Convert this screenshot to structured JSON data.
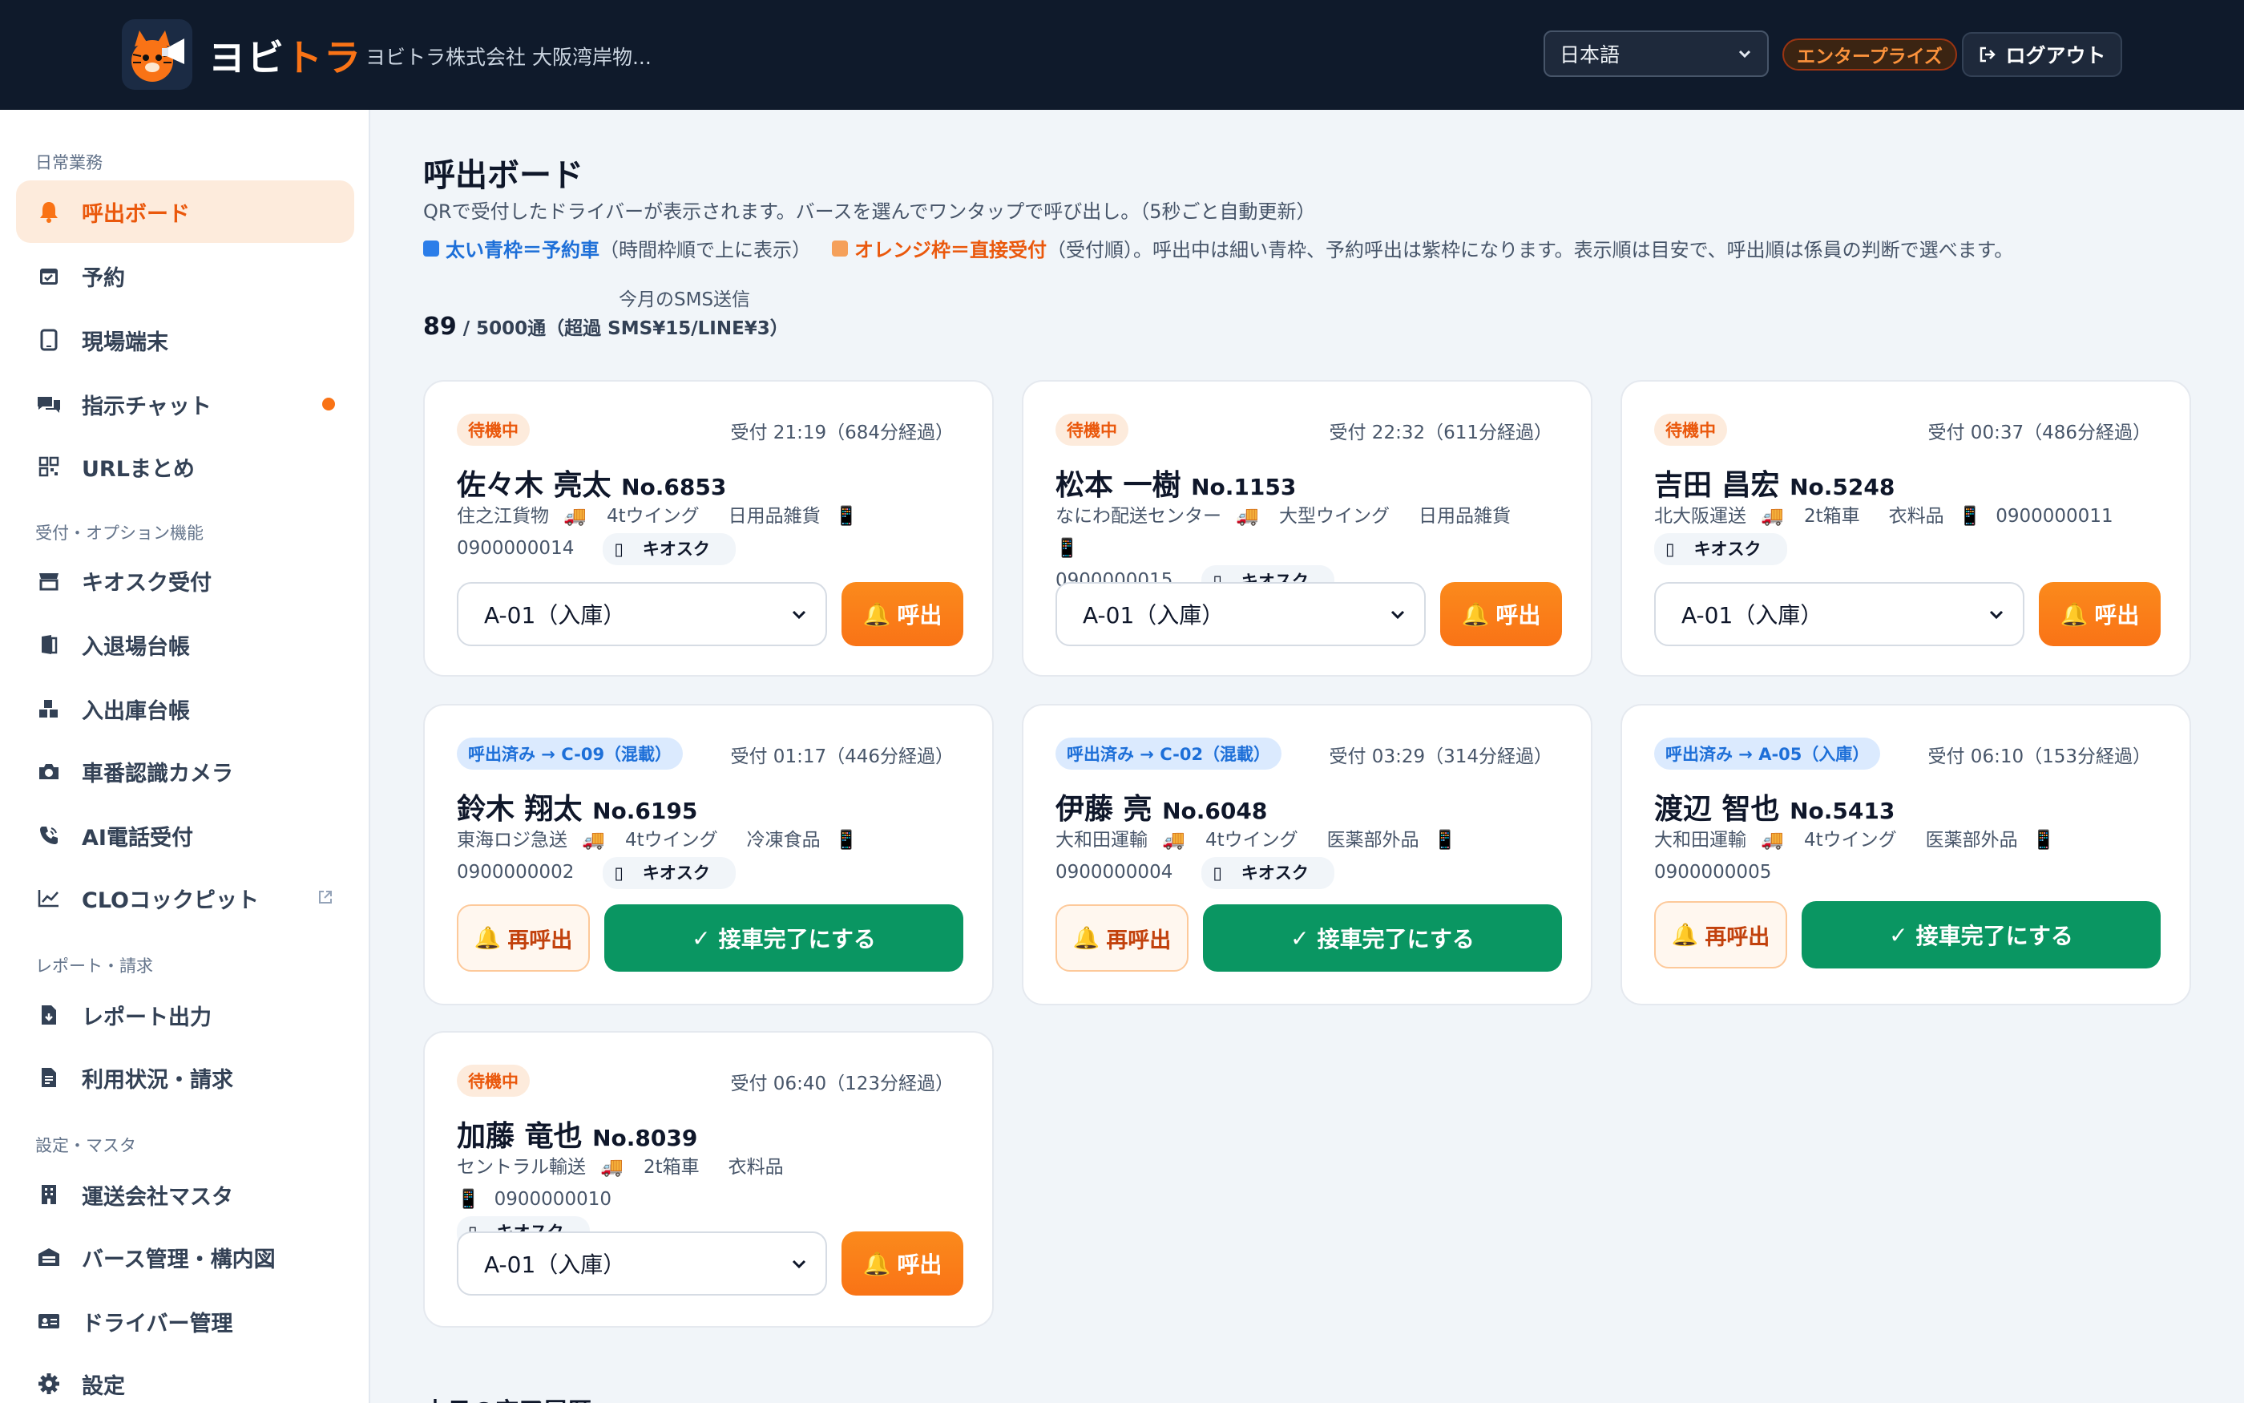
{
  "header": {
    "brand_main": "ヨビ",
    "brand_accent": "トラ",
    "company": "ヨビトラ株式会社 大阪湾岸物...",
    "language": "日本語",
    "plan_badge": "エンタープライズ",
    "logout_label": "ログアウト"
  },
  "sidebar": {
    "sections": [
      "日常業務",
      "受付・オプション機能",
      "レポート・請求",
      "設定・マスタ"
    ],
    "items": [
      {
        "label": "呼出ボード",
        "icon": "bell-icon"
      },
      {
        "label": "予約",
        "icon": "calendar-icon"
      },
      {
        "label": "現場端末",
        "icon": "tablet-icon"
      },
      {
        "label": "指示チャット",
        "icon": "chat-icon"
      },
      {
        "label": "URLまとめ",
        "icon": "qr-icon"
      },
      {
        "label": "キオスク受付",
        "icon": "store-icon"
      },
      {
        "label": "入退場台帳",
        "icon": "door-icon"
      },
      {
        "label": "入出庫台帳",
        "icon": "boxes-icon"
      },
      {
        "label": "車番認識カメラ",
        "icon": "camera-icon"
      },
      {
        "label": "AI電話受付",
        "icon": "phone-icon"
      },
      {
        "label": "CLOコックピット",
        "icon": "chart-line-icon"
      },
      {
        "label": "レポート出力",
        "icon": "file-download-icon"
      },
      {
        "label": "利用状況・請求",
        "icon": "invoice-icon"
      },
      {
        "label": "運送会社マスタ",
        "icon": "building-icon"
      },
      {
        "label": "バース管理・構内図",
        "icon": "warehouse-icon"
      },
      {
        "label": "ドライバー管理",
        "icon": "id-card-icon"
      },
      {
        "label": "設定",
        "icon": "gear-icon"
      }
    ]
  },
  "main": {
    "title": "呼出ボード",
    "description": "QRで受付したドライバーが表示されます。バースを選んでワンタップで呼び出し。（5秒ごと自動更新）",
    "legend": {
      "blue_label": "太い青枠＝予約車",
      "blue_note": "（時間枠順で上に表示）",
      "orange_label": "オレンジ枠＝直接受付",
      "orange_note": "（受付順）。呼出中は細い青枠、予約呼出は紫枠になります。表示順は目安で、呼出順は係員の判断で選べます。",
      "blue_color": "#2b7de9",
      "orange_color": "#f5a05a"
    },
    "sms": {
      "label": "今月のSMS送信",
      "count": "89",
      "detail": " / 5000通（超過 SMS¥15/LINE¥3）"
    },
    "history_title": "本日の完了履歴"
  },
  "cards": [
    {
      "status": "待機中",
      "received": "受付 21:19（684分経過）",
      "name": "佐々木 亮太",
      "number": "No.6853",
      "company": "住之江貨物",
      "vehicle": "4tウイング",
      "cargo": "日用品雑貨",
      "phone": "0900000014",
      "kiosk": "キオスク",
      "berth": "A-01（入庫）",
      "call_label": "呼出"
    },
    {
      "status": "待機中",
      "received": "受付 22:32（611分経過）",
      "name": "松本 一樹",
      "number": "No.1153",
      "company": "なにわ配送センター",
      "vehicle": "大型ウイング",
      "cargo": "日用品雑貨",
      "phone": "0900000015",
      "kiosk": "キオスク",
      "berth": "A-01（入庫）",
      "call_label": "呼出"
    },
    {
      "status": "待機中",
      "received": "受付 00:37（486分経過）",
      "name": "吉田 昌宏",
      "number": "No.5248",
      "company": "北大阪運送",
      "vehicle": "2t箱車",
      "cargo": "衣料品",
      "phone": "0900000011",
      "kiosk": "キオスク",
      "berth": "A-01（入庫）",
      "call_label": "呼出"
    },
    {
      "status": "呼出済み → C-09（混載）",
      "received": "受付 01:17（446分経過）",
      "name": "鈴木 翔太",
      "number": "No.6195",
      "company": "東海ロジ急送",
      "vehicle": "4tウイング",
      "cargo": "冷凍食品",
      "phone": "0900000002",
      "kiosk": "キオスク",
      "recall_label": "再呼出",
      "done_label": "接車完了にする"
    },
    {
      "status": "呼出済み → C-02（混載）",
      "received": "受付 03:29（314分経過）",
      "name": "伊藤 亮",
      "number": "No.6048",
      "company": "大和田運輸",
      "vehicle": "4tウイング",
      "cargo": "医薬部外品",
      "phone": "0900000004",
      "kiosk": "キオスク",
      "recall_label": "再呼出",
      "done_label": "接車完了にする"
    },
    {
      "status": "呼出済み → A-05（入庫）",
      "received": "受付 06:10（153分経過）",
      "name": "渡辺 智也",
      "number": "No.5413",
      "company": "大和田運輸",
      "vehicle": "4tウイング",
      "cargo": "医薬部外品",
      "phone": "0900000005",
      "recall_label": "再呼出",
      "done_label": "接車完了にする"
    },
    {
      "status": "待機中",
      "received": "受付 06:40（123分経過）",
      "name": "加藤 竜也",
      "number": "No.8039",
      "company": "セントラル輸送",
      "vehicle": "2t箱車",
      "cargo": "衣料品",
      "phone": "0900000010",
      "kiosk": "キオスク",
      "berth": "A-01（入庫）",
      "call_label": "呼出"
    }
  ]
}
